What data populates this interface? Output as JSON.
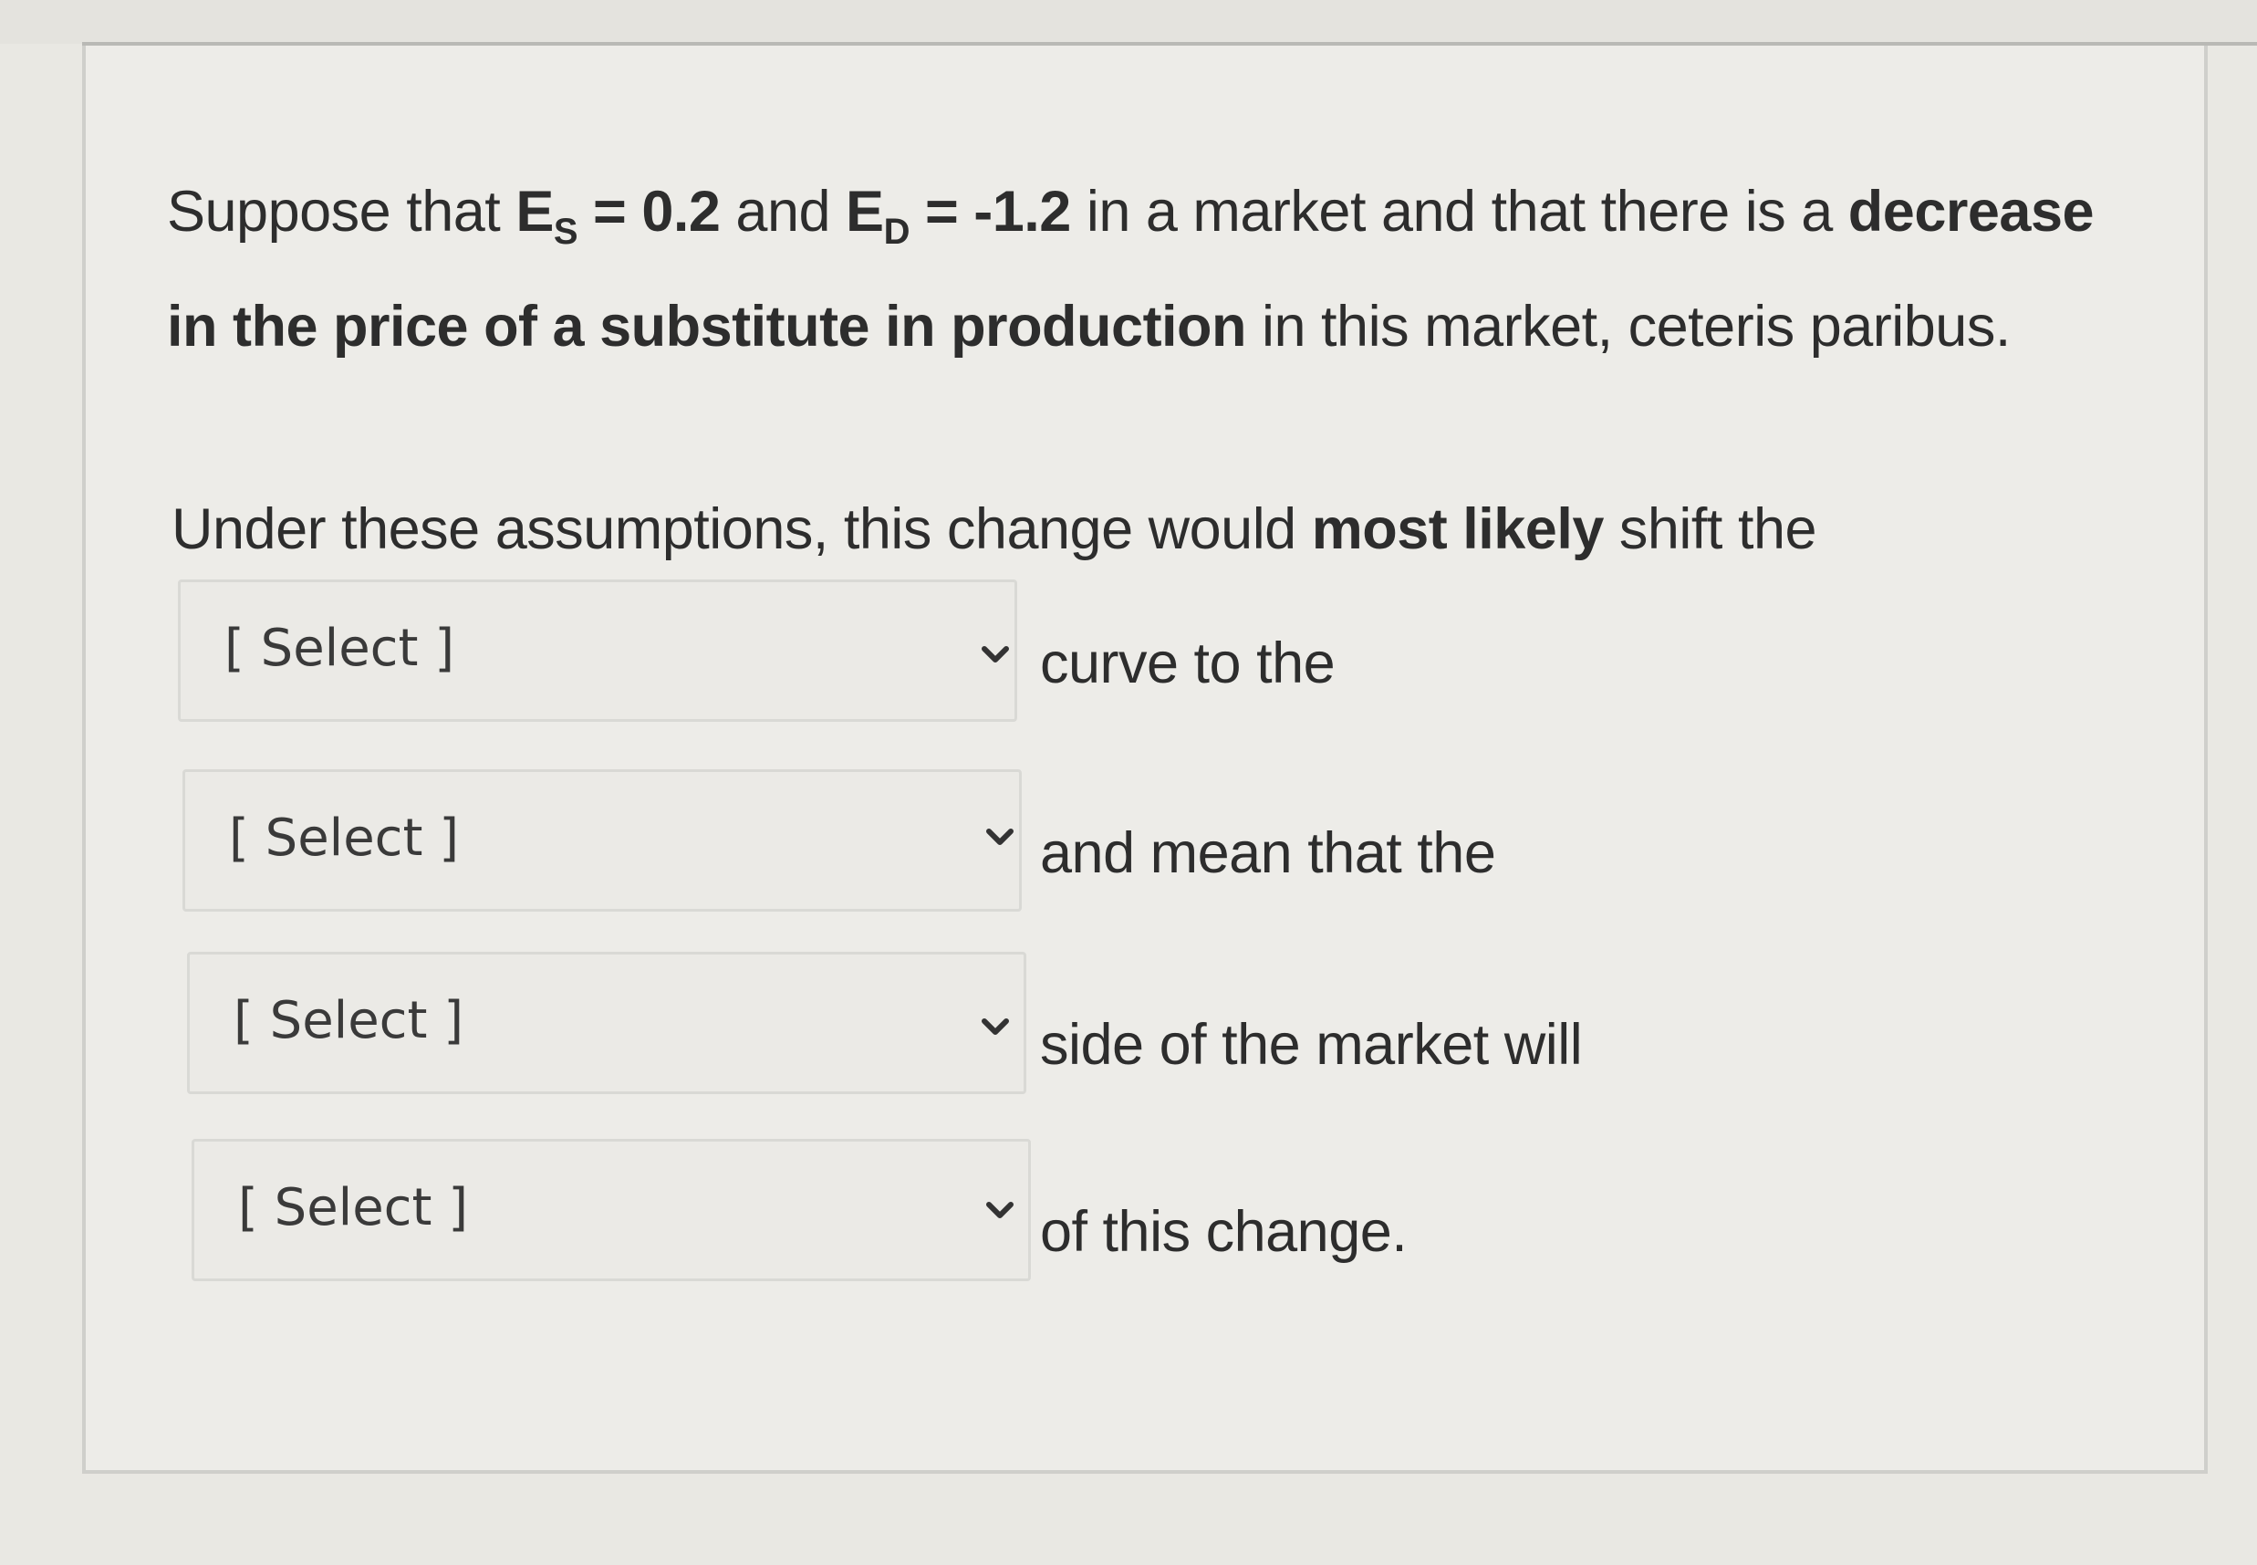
{
  "question": {
    "p1_a": "Suppose that ",
    "es_main": "E",
    "es_sub": "S",
    "p1_b": " = 0.2",
    "p1_c": " and ",
    "ed_main": "E",
    "ed_sub": "D",
    "p1_d": " = -1.2",
    "p1_e": " in a market and that there is a ",
    "p1_bold": "decrease in the price of a substitute in production",
    "p1_f": " in this market, ceteris paribus.",
    "p2_a": "Under these assumptions, this change would ",
    "p2_bold": "most likely",
    "p2_b": " shift the"
  },
  "dropdowns": [
    {
      "value": "[ Select ]",
      "after_text": "curve to the"
    },
    {
      "value": "[ Select ]",
      "after_text": "and mean that the"
    },
    {
      "value": "[ Select ]",
      "after_text": "side of the market will"
    },
    {
      "value": "[ Select ]",
      "after_text": "of this change."
    }
  ],
  "icons": {
    "dropdown": "chevron-down-icon"
  }
}
